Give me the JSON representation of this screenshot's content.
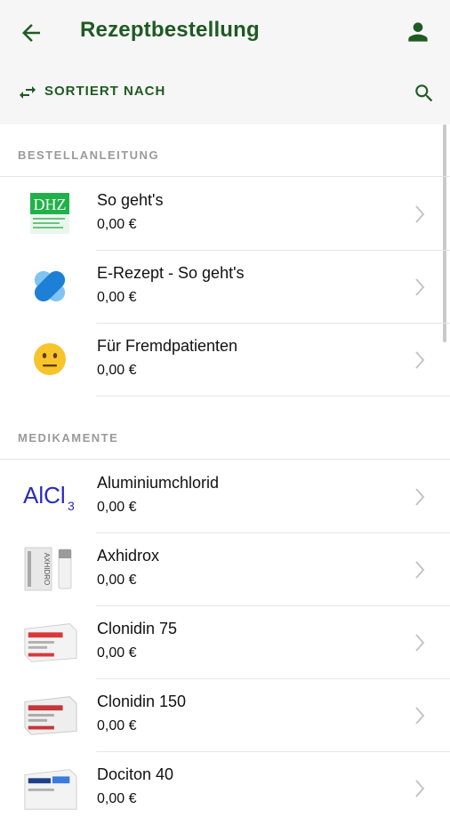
{
  "header": {
    "title": "Rezeptbestellung"
  },
  "sortbar": {
    "label": "SORTIERT NACH"
  },
  "sections": [
    {
      "heading": "BESTELLANLEITUNG",
      "items": [
        {
          "name": "So geht's",
          "price": "0,00 €",
          "thumb": "DHZ"
        },
        {
          "name": "E-Rezept - So geht's",
          "price": "0,00 €",
          "thumb": "erezept-logo"
        },
        {
          "name": "Für Fremdpatienten",
          "price": "0,00 €",
          "thumb": "neutral-face-emoji"
        }
      ]
    },
    {
      "heading": "MEDIKAMENTE",
      "items": [
        {
          "name": "Aluminiumchlorid",
          "price": "0,00 €",
          "thumb": "AlCl",
          "thumb_sub": "3"
        },
        {
          "name": "Axhidrox",
          "price": "0,00 €",
          "thumb": "AXHIDRO"
        },
        {
          "name": "Clonidin 75",
          "price": "0,00 €",
          "thumb": "pill-box"
        },
        {
          "name": "Clonidin 150",
          "price": "0,00 €",
          "thumb": "pill-box"
        },
        {
          "name": "Dociton 40",
          "price": "0,00 €",
          "thumb": "pill-box-blue"
        }
      ]
    }
  ],
  "colors": {
    "primary": "#1f5a23",
    "muted": "#9a9a9a",
    "bar": "#f6f6f6"
  }
}
